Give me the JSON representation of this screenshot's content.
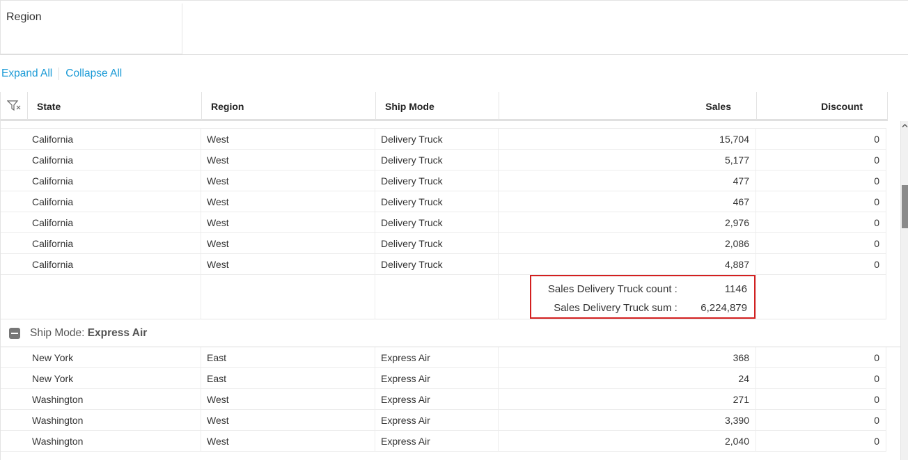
{
  "grouping": {
    "chip_label": "Region"
  },
  "links": {
    "expand_all": "Expand All",
    "collapse_all": "Collapse All"
  },
  "columns": {
    "state": "State",
    "region": "Region",
    "ship_mode": "Ship Mode",
    "sales": "Sales",
    "discount": "Discount"
  },
  "rows_delivery": [
    {
      "state": "California",
      "region": "West",
      "ship_mode": "Delivery Truck",
      "sales": "15,704",
      "discount": "0"
    },
    {
      "state": "California",
      "region": "West",
      "ship_mode": "Delivery Truck",
      "sales": "5,177",
      "discount": "0"
    },
    {
      "state": "California",
      "region": "West",
      "ship_mode": "Delivery Truck",
      "sales": "477",
      "discount": "0"
    },
    {
      "state": "California",
      "region": "West",
      "ship_mode": "Delivery Truck",
      "sales": "467",
      "discount": "0"
    },
    {
      "state": "California",
      "region": "West",
      "ship_mode": "Delivery Truck",
      "sales": "2,976",
      "discount": "0"
    },
    {
      "state": "California",
      "region": "West",
      "ship_mode": "Delivery Truck",
      "sales": "2,086",
      "discount": "0"
    },
    {
      "state": "California",
      "region": "West",
      "ship_mode": "Delivery Truck",
      "sales": "4,887",
      "discount": "0"
    }
  ],
  "summary": {
    "count_label": "Sales Delivery Truck count :",
    "count_value": "1146",
    "sum_label": "Sales Delivery Truck sum :",
    "sum_value": "6,224,879"
  },
  "group_express": {
    "prefix": "Ship Mode: ",
    "name": "Express Air"
  },
  "rows_express": [
    {
      "state": "New York",
      "region": "East",
      "ship_mode": "Express Air",
      "sales": "368",
      "discount": "0"
    },
    {
      "state": "New York",
      "region": "East",
      "ship_mode": "Express Air",
      "sales": "24",
      "discount": "0"
    },
    {
      "state": "Washington",
      "region": "West",
      "ship_mode": "Express Air",
      "sales": "271",
      "discount": "0"
    },
    {
      "state": "Washington",
      "region": "West",
      "ship_mode": "Express Air",
      "sales": "3,390",
      "discount": "0"
    },
    {
      "state": "Washington",
      "region": "West",
      "ship_mode": "Express Air",
      "sales": "2,040",
      "discount": "0"
    }
  ],
  "colors": {
    "link": "#1a9ad6",
    "summary_border": "#d32020"
  },
  "icons": {
    "filter": "filter-icon",
    "group_toggle": "collapse-icon",
    "scroll_up": "chevron-up-icon"
  }
}
